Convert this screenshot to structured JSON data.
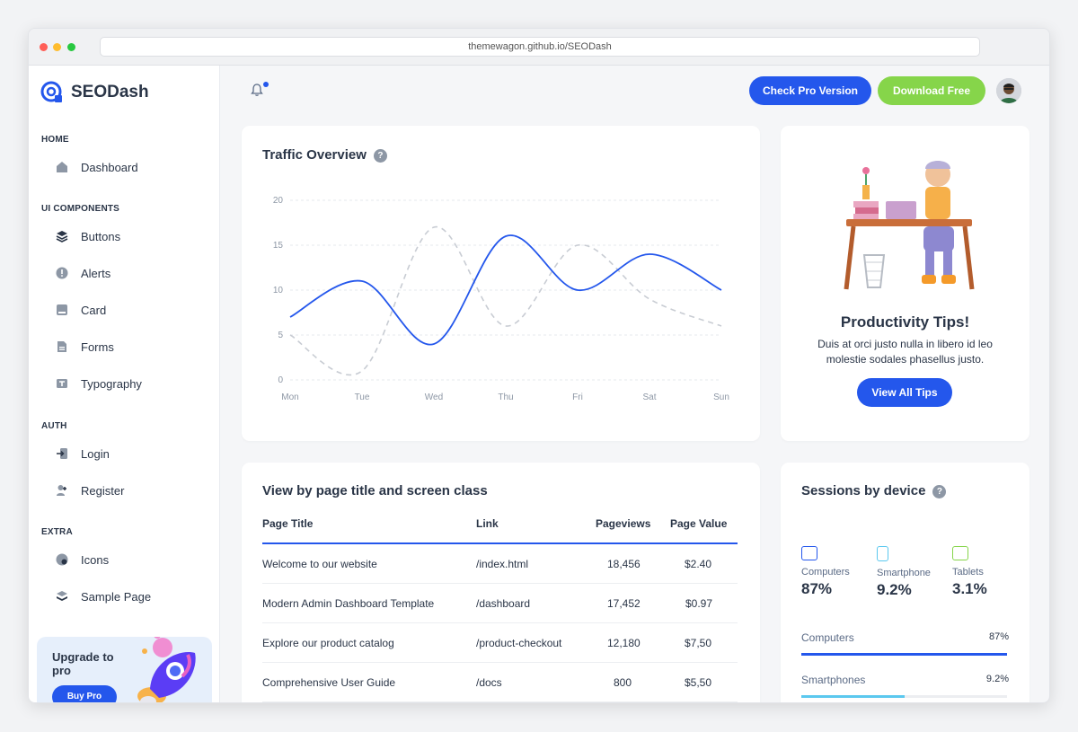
{
  "browser": {
    "url": "themewagon.github.io/SEODash"
  },
  "sidebar": {
    "brand": "SEODash",
    "sections": {
      "home": "HOME",
      "ui": "UI COMPONENTS",
      "auth": "AUTH",
      "extra": "EXTRA"
    },
    "items": [
      {
        "label": "Dashboard",
        "icon": "home-icon"
      },
      {
        "label": "Buttons",
        "icon": "layers-icon"
      },
      {
        "label": "Alerts",
        "icon": "alert-icon"
      },
      {
        "label": "Card",
        "icon": "card-icon"
      },
      {
        "label": "Forms",
        "icon": "file-icon"
      },
      {
        "label": "Typography",
        "icon": "typography-icon"
      },
      {
        "label": "Login",
        "icon": "login-icon"
      },
      {
        "label": "Register",
        "icon": "user-plus-icon"
      },
      {
        "label": "Icons",
        "icon": "mood-icon"
      },
      {
        "label": "Sample Page",
        "icon": "stack-icon"
      }
    ],
    "upgrade": {
      "title": "Upgrade to pro",
      "button": "Buy Pro"
    }
  },
  "header": {
    "pro_button": "Check Pro Version",
    "download_button": "Download Free"
  },
  "traffic": {
    "title": "Traffic Overview",
    "help": "?"
  },
  "chart_data": {
    "type": "line",
    "categories": [
      "Mon",
      "Tue",
      "Wed",
      "Thu",
      "Fri",
      "Sat",
      "Sun"
    ],
    "ylim": [
      0,
      20
    ],
    "yticks": [
      0,
      5,
      10,
      15,
      20
    ],
    "grid": true,
    "series": [
      {
        "values": [
          7,
          11,
          4,
          16,
          10,
          14,
          10
        ],
        "color": "#2457ec",
        "style": "solid"
      },
      {
        "values": [
          5,
          1,
          17,
          6,
          15,
          9,
          6
        ],
        "color": "#c8ccd3",
        "style": "dashed"
      }
    ]
  },
  "tips": {
    "title": "Productivity Tips!",
    "text": "Duis at orci justo nulla in libero id leo molestie sodales phasellus justo.",
    "button": "View All Tips"
  },
  "pages": {
    "title": "View by page title and screen class",
    "headers": {
      "title": "Page Title",
      "link": "Link",
      "views": "Pageviews",
      "value": "Page Value"
    },
    "rows": [
      {
        "title": "Welcome to our website",
        "link": "/index.html",
        "views": "18,456",
        "value": "$2.40"
      },
      {
        "title": "Modern Admin Dashboard Template",
        "link": "/dashboard",
        "views": "17,452",
        "value": "$0.97"
      },
      {
        "title": "Explore our product catalog",
        "link": "/product-checkout",
        "views": "12,180",
        "value": "$7,50"
      },
      {
        "title": "Comprehensive User Guide",
        "link": "/docs",
        "views": "800",
        "value": "$5,50"
      }
    ]
  },
  "sessions": {
    "title": "Sessions by device",
    "help": "?",
    "devices": [
      {
        "label": "Computers",
        "value": "87%",
        "color": "#2457ec"
      },
      {
        "label": "Smartphone",
        "value": "9.2%",
        "color": "#5bc8ef"
      },
      {
        "label": "Tablets",
        "value": "3.1%",
        "color": "#86d54a"
      }
    ],
    "bars": [
      {
        "label": "Computers",
        "pct": "87%",
        "fraction": 1.0,
        "color": "#2457ec"
      },
      {
        "label": "Smartphones",
        "pct": "9.2%",
        "fraction": 0.5,
        "color": "#5bc8ef"
      }
    ]
  }
}
